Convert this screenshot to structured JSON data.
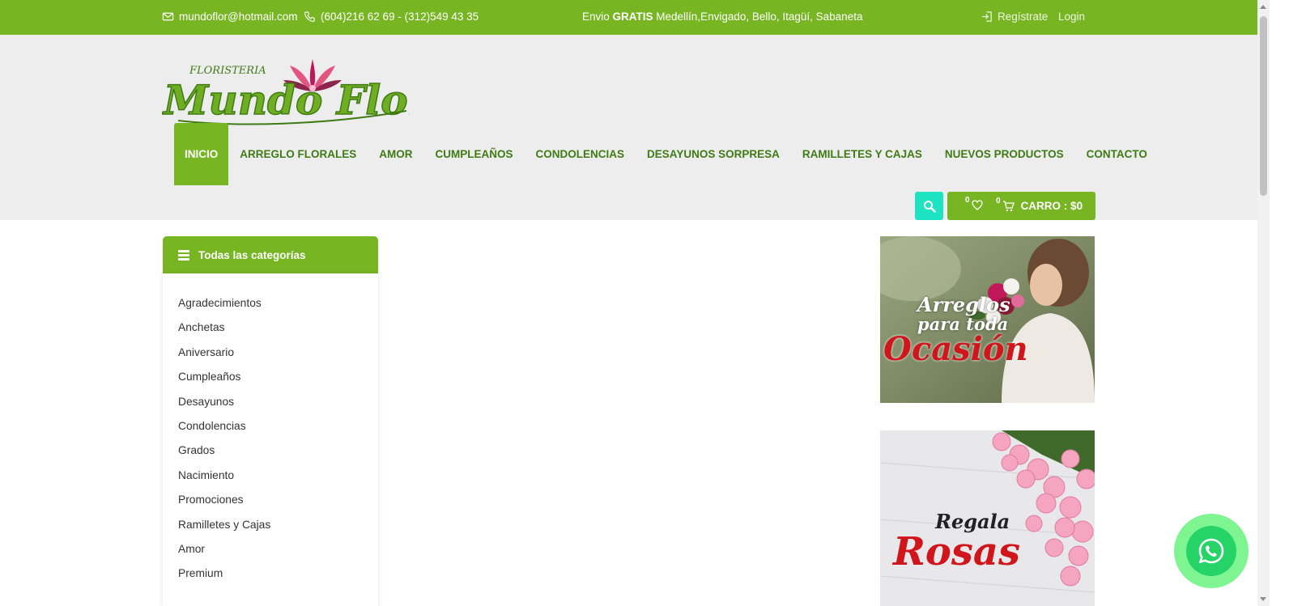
{
  "topbar": {
    "email": "mundoflor@hotmail.com",
    "phone": "(604)216 62 69 - (312)549 43 35",
    "shipping_prefix": "Envio ",
    "shipping_bold": "GRATIS",
    "shipping_suffix": " Medellín,Envigado, Bello, Itagüí, Sabaneta",
    "register": "Regístrate",
    "login": "Login"
  },
  "logo": {
    "small": "FLORISTERIA",
    "main": "Mundo Flor"
  },
  "nav": {
    "items": [
      {
        "label": "INICIO"
      },
      {
        "label": "ARREGLO FLORALES"
      },
      {
        "label": "AMOR"
      },
      {
        "label": "CUMPLEAÑOS"
      },
      {
        "label": "CONDOLENCIAS"
      },
      {
        "label": "DESAYUNOS SORPRESA"
      },
      {
        "label": "RAMILLETES Y CAJAS"
      },
      {
        "label": "NUEVOS PRODUCTOS"
      },
      {
        "label": "CONTACTO"
      }
    ]
  },
  "cart": {
    "wishlist_count": "0",
    "cart_count": "0",
    "label": "CARRO : $0"
  },
  "sidebar": {
    "title": "Todas las categorías",
    "items": [
      {
        "label": "Agradecimientos"
      },
      {
        "label": "Anchetas"
      },
      {
        "label": "Aniversario"
      },
      {
        "label": "Cumpleaños"
      },
      {
        "label": "Desayunos"
      },
      {
        "label": "Condolencias"
      },
      {
        "label": "Grados"
      },
      {
        "label": "Nacimiento"
      },
      {
        "label": "Promociones"
      },
      {
        "label": "Ramilletes y Cajas"
      },
      {
        "label": "Amor"
      },
      {
        "label": "Premium"
      }
    ]
  },
  "banners": {
    "b1": {
      "line1": "Arreglos",
      "line2": "para toda",
      "line3": "Ocasión"
    },
    "b2": {
      "line1": "Regala",
      "line2": "Rosas"
    }
  },
  "colors": {
    "brand_green": "#77b523",
    "dark_green": "#3f7b14",
    "accent_teal": "#1ee3c2",
    "banner_red": "#d0151c"
  },
  "icons": [
    "envelope-icon",
    "phone-icon",
    "login-icon",
    "search-icon",
    "heart-icon",
    "cart-icon",
    "list-icon",
    "whatsapp-icon"
  ]
}
